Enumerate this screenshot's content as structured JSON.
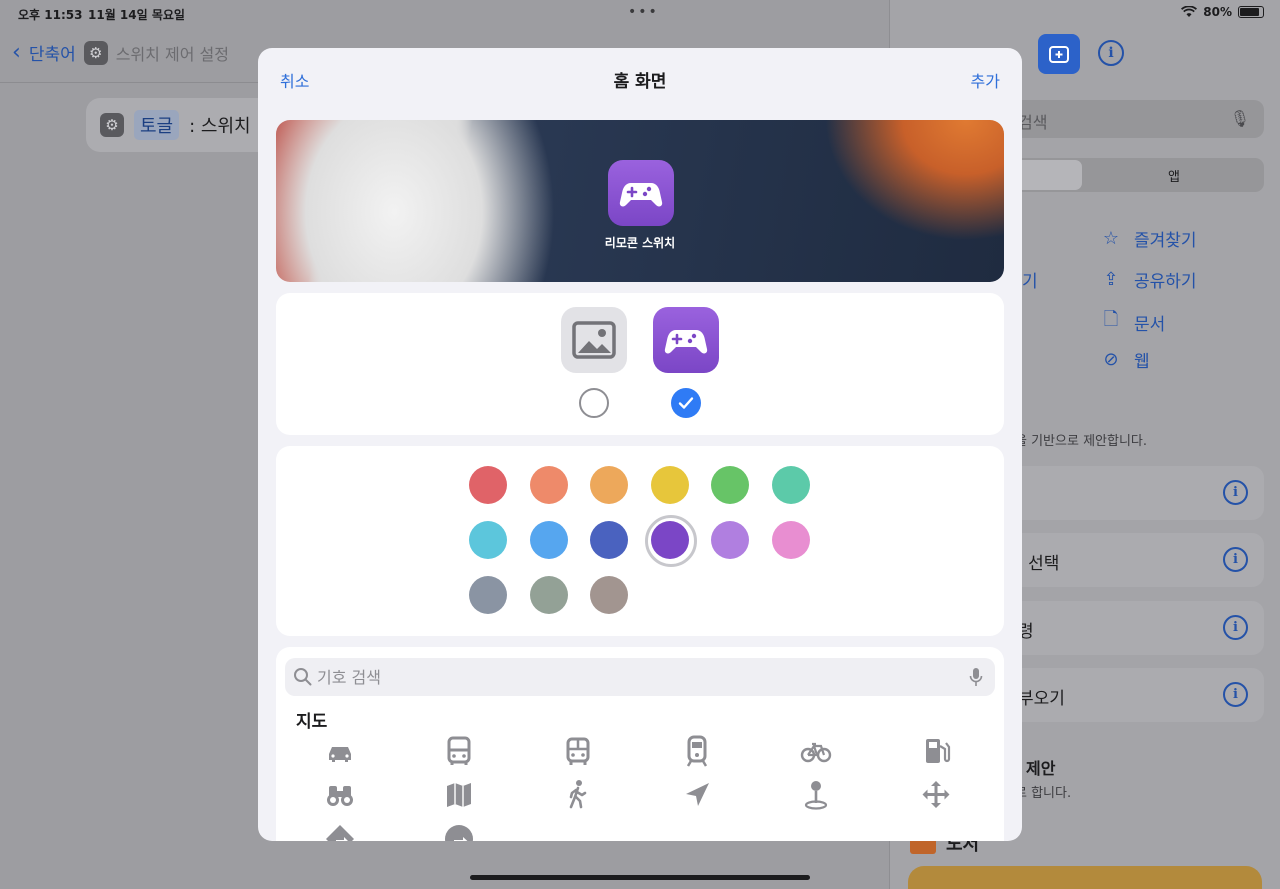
{
  "status_bar": {
    "time": "오후 11:53",
    "date": "11월 14일 목요일",
    "battery": "80%"
  },
  "background": {
    "back_label": "단축어",
    "shortcut_title": "스위치 제어 설정",
    "action_token": "토글",
    "action_text": ": 스위치",
    "right_panel": {
      "search_placeholder": "검색",
      "segment_label": "앱",
      "categories": [
        "즐겨찾기",
        "공유하기",
        "문서",
        "웹"
      ],
      "partial_left": "기",
      "note": "을 기반으로 제안합니다.",
      "rows": [
        "",
        "l 선택",
        "령",
        "부오기"
      ],
      "suggest_title": "l 제안",
      "suggest_sub": "로 합니다.",
      "book_label": "도서"
    }
  },
  "sheet": {
    "cancel_label": "취소",
    "title": "홈 화면",
    "add_label": "추가",
    "preview": {
      "app_name": "리모콘 스위치"
    },
    "icon_options": {
      "selected": "glyph"
    },
    "colors": {
      "selected_index": 9,
      "swatches": [
        "#e06368",
        "#ee8a6a",
        "#eda85b",
        "#e7c63b",
        "#67c467",
        "#5ccaa9",
        "#5cc6dc",
        "#56a6ef",
        "#4a62bf",
        "#7b46c6",
        "#b07fe0",
        "#e88ed1",
        "#8a94a3",
        "#93a196",
        "#a29590"
      ]
    },
    "symbols": {
      "search_placeholder": "기호 검색",
      "section_title": "지도",
      "icons": [
        "car-icon",
        "bus-icon",
        "tram-icon",
        "train-icon",
        "bicycle-icon",
        "fuel-pump-icon",
        "binoculars-icon",
        "map-icon",
        "walking-figure-icon",
        "location-arrow-icon",
        "map-pin-icon",
        "move-arrows-icon",
        "turn-right-diamond-icon",
        "turn-right-circle-icon"
      ]
    }
  },
  "colors": {
    "accent": "#2f6fd9",
    "glyph_bg": "#7b46c6"
  }
}
